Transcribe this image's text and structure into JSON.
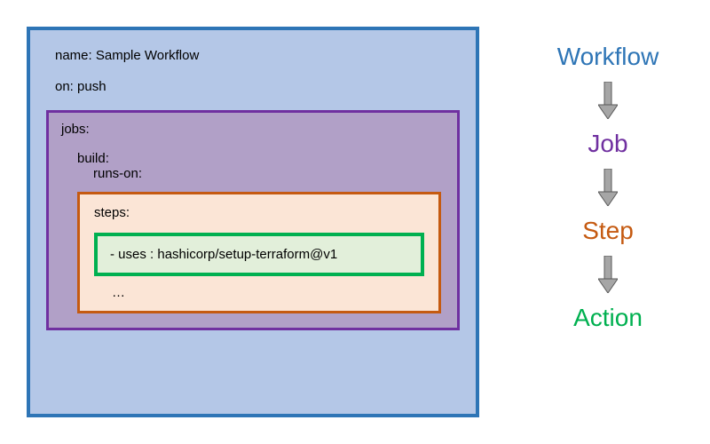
{
  "workflow": {
    "name_line": "name: Sample Workflow",
    "on_line": "on: push"
  },
  "jobs": {
    "label": "jobs:",
    "build_line": "build:",
    "runs_line": "runs-on:"
  },
  "steps": {
    "label": "steps:",
    "dots": "…"
  },
  "action": {
    "line": "- uses : hashicorp/setup-terraform@v1"
  },
  "legend": {
    "workflow": "Workflow",
    "job": "Job",
    "step": "Step",
    "action": "Action"
  }
}
